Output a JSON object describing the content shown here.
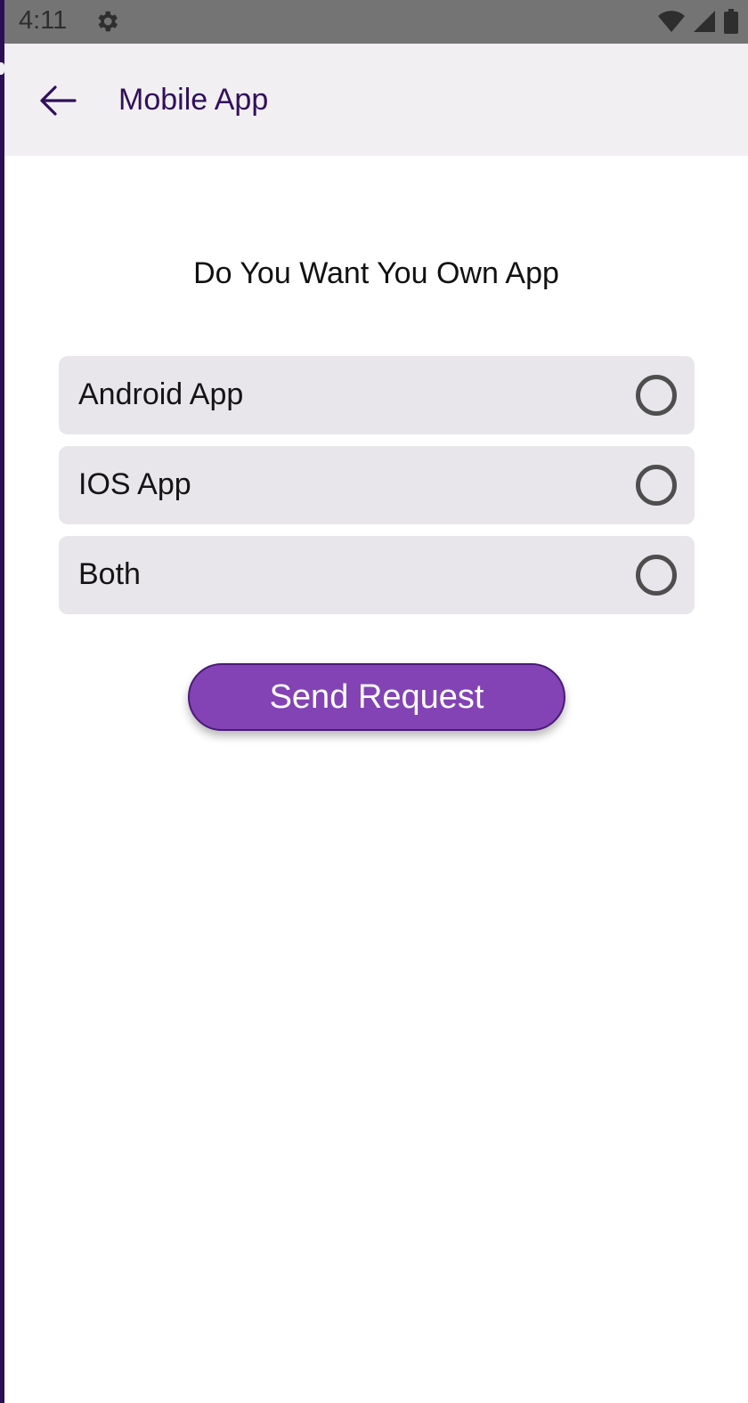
{
  "status_bar": {
    "time": "4:11",
    "icons": [
      "gear-icon",
      "wifi-icon",
      "cell-signal-icon",
      "battery-icon"
    ]
  },
  "app_bar": {
    "title": "Mobile App",
    "back_icon": "arrow-left-icon"
  },
  "main": {
    "question": "Do You Want You Own App",
    "options": [
      {
        "label": "Android App",
        "selected": false
      },
      {
        "label": "IOS App",
        "selected": false
      },
      {
        "label": "Both",
        "selected": false
      }
    ],
    "send_button_label": "Send Request"
  },
  "colors": {
    "accent": "#8343b4",
    "title_text": "#30105a",
    "app_bar_bg": "#f2eff3",
    "option_bg": "#e8e6ea",
    "status_bar_bg": "#747474"
  }
}
